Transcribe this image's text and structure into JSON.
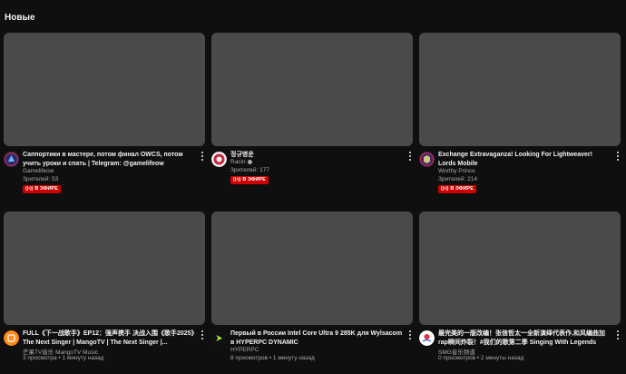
{
  "section": {
    "title": "Новые"
  },
  "live_label": "В ЭФИРЕ",
  "cards": [
    {
      "title": "Саппортики в мастере, потом финал OWCS, потом учить уроки и спать | Telegram: @gamelifeow",
      "channel": "Gamelifeow",
      "stats": "Зрителей: 53",
      "live": true,
      "avatar_color": "#2a2a6a",
      "avatar_icon": "triangle-logo-icon"
    },
    {
      "title": "정규병운",
      "channel": "Racin",
      "stats": "Зрителей: 177",
      "live": true,
      "verified": true,
      "avatar_color": "#c4283c",
      "avatar_icon": "round-badge-logo-icon"
    },
    {
      "title": "Exchange Extravaganza! Looking For Lightweaver! Lords Mobile",
      "channel": "Worthy Prince",
      "stats": "Зрителей: 214",
      "live": true,
      "avatar_color": "#3a2a6a",
      "avatar_icon": "emblem-logo-icon"
    },
    {
      "title": "FULL《下一战歌手》EP12：强声携手 决战入围《歌手2025》The Next Singer | MangoTV | The Next Singer |...",
      "channel": "芒果TV音乐 MangoTV Music",
      "stats": "3 просмотра • 1 минуту назад",
      "live": false,
      "avatar_color": "#ff8a1c",
      "avatar_icon": "mango-logo-icon"
    },
    {
      "title": "Первый в России Intel Core Ultra 9 285K для Wylsacom в HYPERPC DYNAMIC",
      "channel": "HYPERPC",
      "stats": "8 просмотров • 1 минуту назад",
      "live": false,
      "avatar_color": "#111111",
      "avatar_icon": "hyperpc-logo-icon"
    },
    {
      "title": "最完美的一版改编！张信哲太一全新演绎代表作,和风编曲加rap瞬间炸裂！#我们的歌第二季 Singing With Legends S2...",
      "channel": "SMG音乐频道",
      "stats": "0 просмотров • 2 минуты назад",
      "live": false,
      "avatar_color": "#ffffff",
      "avatar_icon": "smg-logo-icon"
    }
  ]
}
